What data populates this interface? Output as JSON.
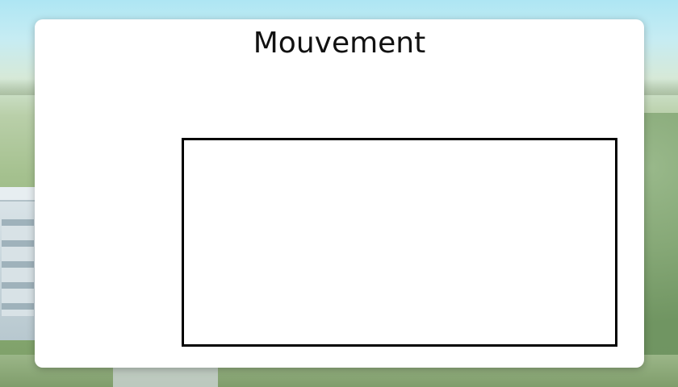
{
  "page": {
    "title": "Mouvement"
  },
  "movement_area": {
    "label": ""
  },
  "colors": {
    "card_background": "#ffffff",
    "title_text": "#111111",
    "area_border": "#000000"
  },
  "icons": []
}
